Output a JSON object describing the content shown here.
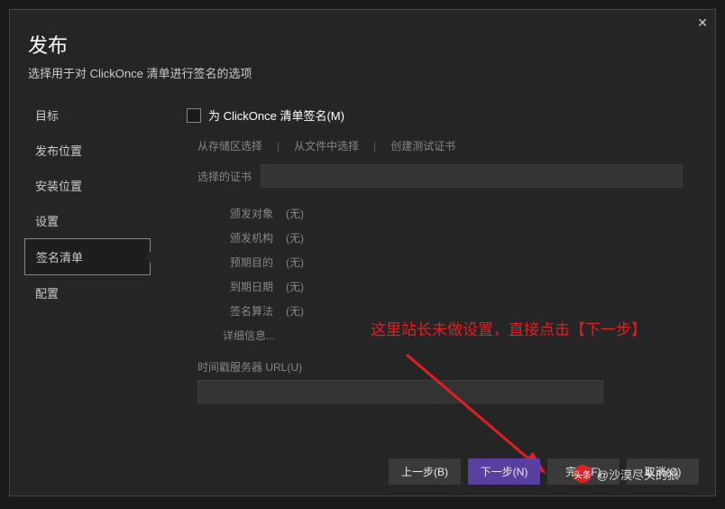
{
  "dialog": {
    "title": "发布",
    "subtitle": "选择用于对 ClickOnce 清单进行签名的选项"
  },
  "sidebar": {
    "items": [
      {
        "label": "目标"
      },
      {
        "label": "发布位置"
      },
      {
        "label": "安装位置"
      },
      {
        "label": "设置"
      },
      {
        "label": "签名清单"
      },
      {
        "label": "配置"
      }
    ]
  },
  "sign": {
    "checkbox_label": "为 ClickOnce 清单签名(M)",
    "source_store": "从存储区选择",
    "source_file": "从文件中选择",
    "source_test": "创建测试证书",
    "selected_cert_label": "选择的证书",
    "issued_to_label": "颁发对象",
    "issued_to": "(无)",
    "issued_by_label": "颁发机构",
    "issued_by": "(无)",
    "purpose_label": "预期目的",
    "purpose": "(无)",
    "expiry_label": "到期日期",
    "expiry": "(无)",
    "algo_label": "签名算法",
    "algo": "(无)",
    "details": "详细信息...",
    "ts_label": "时间戳服务器 URL(U)"
  },
  "annotation": "这里站长未做设置，直接点击【下一步】",
  "buttons": {
    "prev": "上一步(B)",
    "next": "下一步(N)",
    "finish": "完成(F)",
    "cancel": "取消(C)"
  },
  "watermark": {
    "icon": "头条",
    "text": "@沙漠尽头的狼"
  }
}
